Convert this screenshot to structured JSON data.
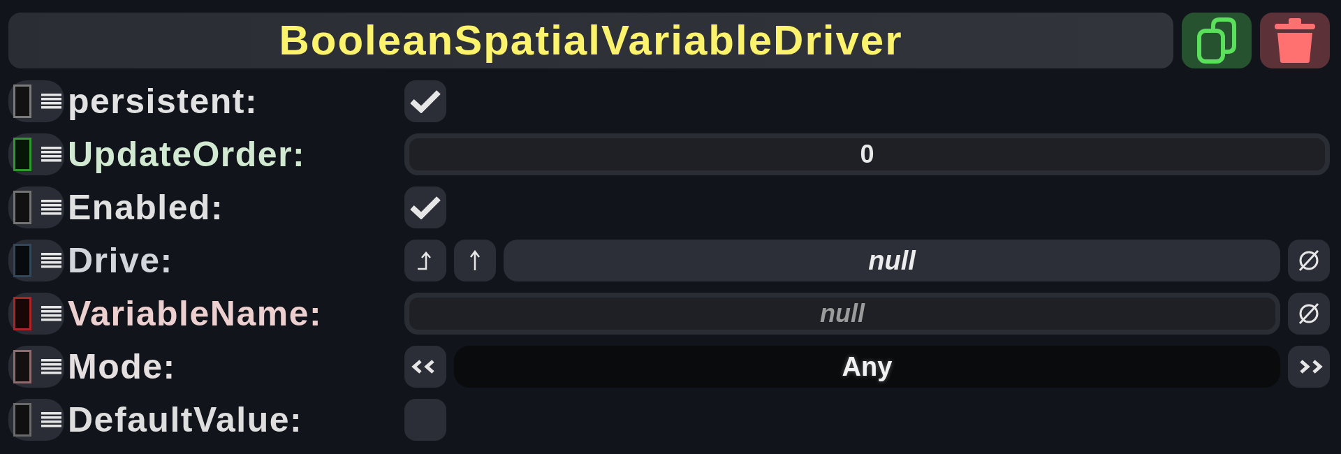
{
  "header": {
    "title": "BooleanSpatialVariableDriver"
  },
  "fields": [
    {
      "label": "persistent:",
      "color": "#7a7a7a",
      "kind": "checkbox",
      "checked": true
    },
    {
      "label": "UpdateOrder:",
      "color": "#2e9a2e",
      "kind": "number",
      "value": "0"
    },
    {
      "label": "Enabled:",
      "color": "#737373",
      "kind": "checkbox",
      "checked": true
    },
    {
      "label": "Drive:",
      "color": "#34465a",
      "kind": "reference",
      "value": "null"
    },
    {
      "label": "VariableName:",
      "color": "#a82626",
      "kind": "text",
      "placeholder": "null"
    },
    {
      "label": "Mode:",
      "color": "#8c6c6c",
      "kind": "enum",
      "value": "Any"
    },
    {
      "label": "DefaultValue:",
      "color": "#6a6a6a",
      "kind": "checkbox",
      "checked": false
    }
  ]
}
